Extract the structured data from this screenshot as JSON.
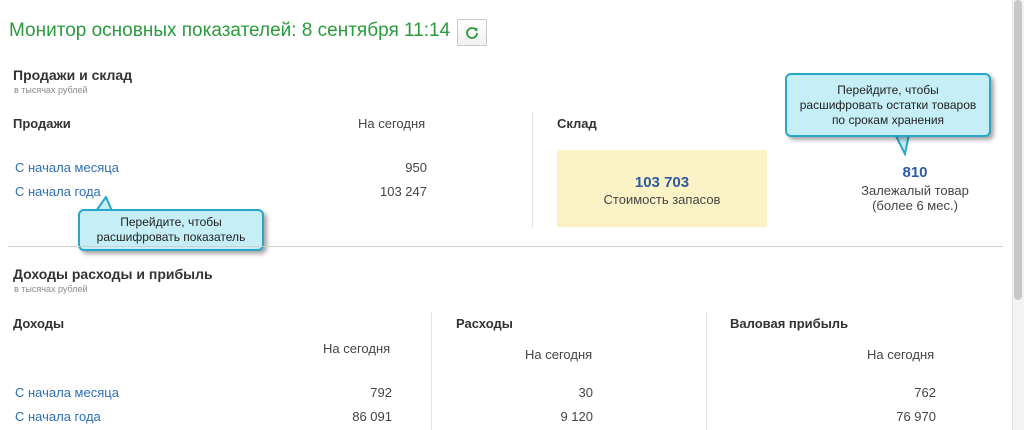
{
  "header": {
    "title": "Монитор основных показателей: 8 сентября 11:14",
    "refresh_icon": "refresh-icon"
  },
  "sales_section": {
    "title": "Продажи и склад",
    "subtitle": "в тысячах рублей",
    "sales": {
      "heading": "Продажи",
      "column": "На сегодня",
      "rows": [
        {
          "label": "С начала месяца",
          "value": "950"
        },
        {
          "label": "С начала года",
          "value": "103 247"
        }
      ]
    },
    "stock": {
      "heading": "Склад",
      "value": "103 703",
      "label": "Стоимость запасов",
      "stale_value": "810",
      "stale_label_1": "Залежалый товар",
      "stale_label_2": "(более 6 мес.)"
    }
  },
  "callouts": {
    "stock_hint": {
      "line1": "Перейдите, чтобы",
      "line2": "расшифровать остатки товаров",
      "line3": "по срокам хранения"
    },
    "sales_hint": {
      "line1": "Перейдите, чтобы",
      "line2": "расшифровать показатель"
    }
  },
  "finance_section": {
    "title": "Доходы расходы и прибыль",
    "subtitle": "в тысячах рублей",
    "income": {
      "heading": "Доходы",
      "column": "На сегодня",
      "rows": [
        {
          "label": "С начала месяца",
          "value": "792"
        },
        {
          "label": "С начала года",
          "value": "86 091"
        }
      ]
    },
    "expenses": {
      "heading": "Расходы",
      "column": "На сегодня",
      "values": [
        "30",
        "9 120"
      ]
    },
    "profit": {
      "heading": "Валовая прибыль",
      "column": "На сегодня",
      "values": [
        "762",
        "76 970"
      ]
    }
  },
  "colors": {
    "title_green": "#2a9a3c",
    "link_blue": "#2d6fb5",
    "value_blue": "#2d5aa0",
    "stock_card_bg": "#fbf3c6",
    "callout_bg": "#c6eef7",
    "callout_border": "#27a7c8"
  }
}
